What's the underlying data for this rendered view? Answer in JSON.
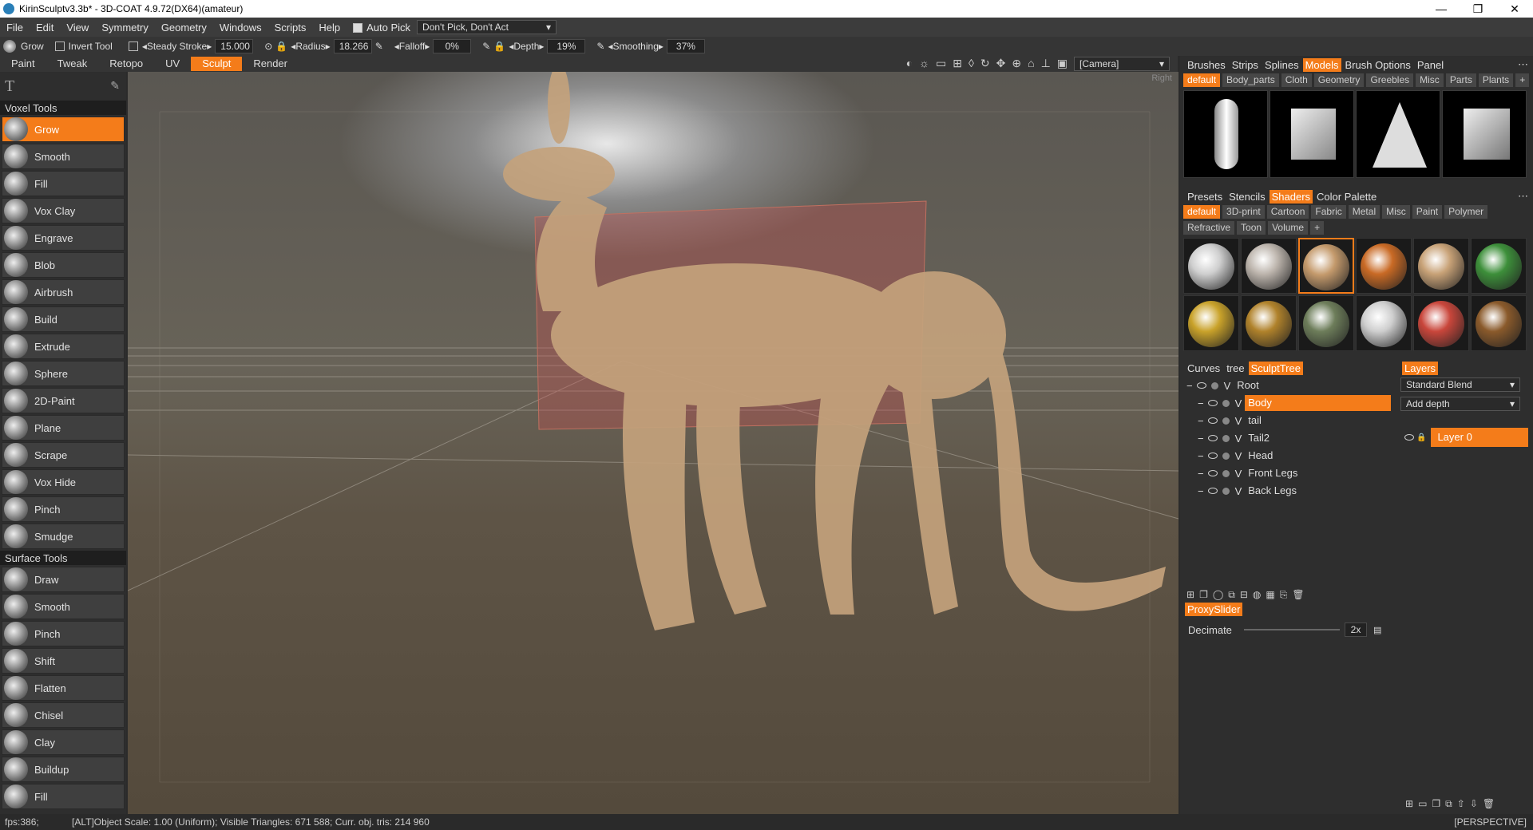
{
  "window": {
    "title": "KirinSculptv3.3b* - 3D-COAT 4.9.72(DX64)(amateur)",
    "min": "—",
    "max": "❐",
    "close": "✕"
  },
  "menu": {
    "items": [
      "File",
      "Edit",
      "View",
      "Symmetry",
      "Geometry",
      "Windows",
      "Scripts",
      "Help"
    ],
    "auto_pick": "Auto Pick",
    "pick_mode": "Don't Pick, Don't Act"
  },
  "options": {
    "tool": "Grow",
    "invert": "Invert Tool",
    "steady": "Steady Stroke",
    "steady_val": "15.000",
    "radius_label": "Radius",
    "radius_val": "18.266",
    "falloff_label": "Falloff",
    "falloff_val": "0%",
    "depth_label": "Depth",
    "depth_val": "19%",
    "smoothing_label": "Smoothing",
    "smoothing_val": "37%"
  },
  "rooms": [
    "Paint",
    "Tweak",
    "Retopo",
    "UV",
    "Sculpt",
    "Render"
  ],
  "active_room": "Sculpt",
  "camera": "[Camera]",
  "viewport": {
    "corner_label": "Right"
  },
  "tools": {
    "voxel_head": "Voxel Tools",
    "voxel": [
      "Grow",
      "Smooth",
      "Fill",
      "Vox Clay",
      "Engrave",
      "Blob",
      "Airbrush",
      "Build",
      "Extrude",
      "Sphere",
      "2D-Paint",
      "Plane",
      "Scrape",
      "Vox Hide",
      "Pinch",
      "Smudge"
    ],
    "surface_head": "Surface Tools",
    "surface": [
      "Draw",
      "Smooth",
      "Pinch",
      "Shift",
      "Flatten",
      "Chisel",
      "Clay",
      "Buildup",
      "Fill"
    ]
  },
  "models_panel": {
    "tabs": [
      "Brushes",
      "Strips",
      "Splines",
      "Models",
      "Brush Options",
      "Panel"
    ],
    "active": "Models",
    "chips": [
      "default",
      "Body_parts",
      "Cloth",
      "Geometry",
      "Greebles",
      "Misc",
      "Parts",
      "Plants",
      "+"
    ]
  },
  "shaders_panel": {
    "tabs": [
      "Presets",
      "Stencils",
      "Shaders",
      "Color Palette"
    ],
    "active": "Shaders",
    "chips": [
      "default",
      "3D-print",
      "Cartoon",
      "Fabric",
      "Metal",
      "Misc",
      "Paint",
      "Polymer",
      "Refractive",
      "Toon",
      "Volume",
      "+"
    ],
    "balls": [
      "#cfcfcf",
      "#bdb5ad",
      "#c49a6c",
      "#c96a25",
      "#c8a277",
      "#3d8f3a",
      "#c9a22a",
      "#b0822b",
      "#6d7d5a",
      "#cfcfcf",
      "#c9463b",
      "#8a5a2b"
    ]
  },
  "tree_panel": {
    "tabs": [
      "Curves",
      "tree",
      "SculptTree"
    ],
    "active": "SculptTree",
    "rows": [
      {
        "label": "Root",
        "vis": "V",
        "indent": 0
      },
      {
        "label": "Body",
        "vis": "V",
        "indent": 1,
        "active": true
      },
      {
        "label": "tail",
        "vis": "V",
        "indent": 1
      },
      {
        "label": "Tail2",
        "vis": "V",
        "indent": 1
      },
      {
        "label": "Head",
        "vis": "V",
        "indent": 1
      },
      {
        "label": "Front Legs",
        "vis": "V",
        "indent": 1
      },
      {
        "label": "Back Legs",
        "vis": "V",
        "indent": 1
      }
    ]
  },
  "layers_panel": {
    "tab": "Layers",
    "blend": "Standard Blend",
    "depth": "Add depth",
    "layer": "Layer 0"
  },
  "proxy": {
    "tab": "ProxySlider",
    "label": "Decimate",
    "value": "2x"
  },
  "status": {
    "fps": "fps:386;",
    "info": "[ALT]Object Scale: 1.00 (Uniform); Visible Triangles: 671 588; Curr. obj. tris: 214 960",
    "mode": "[PERSPECTIVE]"
  },
  "colors": {
    "accent": "#f47c1a",
    "model": "#c4a27c"
  }
}
